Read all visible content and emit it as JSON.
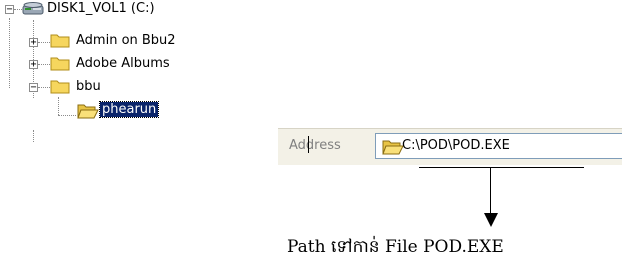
{
  "tree": {
    "drive_label": "DISK1_VOL1 (C:)",
    "items": [
      {
        "label": "Admin on Bbu2",
        "toggle": "+"
      },
      {
        "label": "Adobe Albums",
        "toggle": "+"
      },
      {
        "label": "bbu",
        "toggle": "−"
      },
      {
        "label": "phearun",
        "selected": true
      }
    ],
    "drive_toggle": "−"
  },
  "address_bar": {
    "label": "Address",
    "value": "C:\\POD\\POD.EXE"
  },
  "annotation": {
    "caption": "Path ទៅកាន់ File POD.EXE"
  },
  "colors": {
    "selection_bg": "#0a246a",
    "folder_yellow": "#f6d65e",
    "toolbar_bg": "#f3f1e7"
  }
}
